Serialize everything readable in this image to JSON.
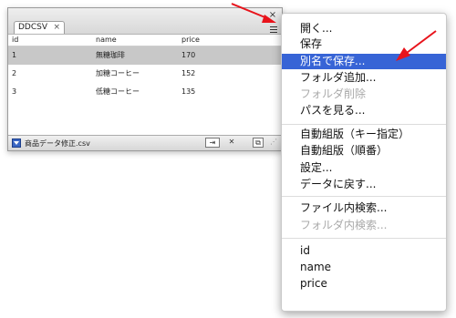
{
  "panel": {
    "tab_label": "DDCSV",
    "tab_close": "×",
    "close_symbol": "×",
    "columns": [
      "id",
      "name",
      "price"
    ],
    "rows": [
      {
        "id": "1",
        "name": "無糖珈琲",
        "price": "170",
        "selected": true
      },
      {
        "id": "2",
        "name": "加糖コーヒー",
        "price": "152",
        "selected": false
      },
      {
        "id": "3",
        "name": "低糖コーヒー",
        "price": "135",
        "selected": false
      }
    ],
    "footer": {
      "file_name": "商品データ修正.csv",
      "export_icon": "⇥",
      "delete_icon": "✕",
      "new_icon": "⧉",
      "resize_icon": "⋰"
    }
  },
  "menu": {
    "items": [
      {
        "label": "開く...",
        "enabled": true
      },
      {
        "label": "保存",
        "enabled": true
      },
      {
        "label": "別名で保存...",
        "enabled": true,
        "highlighted": true
      },
      {
        "label": "フォルダ追加...",
        "enabled": true
      },
      {
        "label": "フォルダ削除",
        "enabled": false
      },
      {
        "label": "パスを見る...",
        "enabled": true
      },
      {
        "label": "自動組版（キー指定）",
        "enabled": true
      },
      {
        "label": "自動組版（順番）",
        "enabled": true
      },
      {
        "label": "設定...",
        "enabled": true
      },
      {
        "label": "データに戻す...",
        "enabled": true
      },
      {
        "label": "ファイル内検索...",
        "enabled": true
      },
      {
        "label": "フォルダ内検索...",
        "enabled": false
      },
      {
        "label": "id",
        "enabled": true
      },
      {
        "label": "name",
        "enabled": true
      },
      {
        "label": "price",
        "enabled": true
      }
    ]
  },
  "colors": {
    "highlight": "#3764d6",
    "arrow": "#e8131b",
    "selected_row": "#c8c8c8",
    "disabled_text": "#a9a9a9"
  }
}
